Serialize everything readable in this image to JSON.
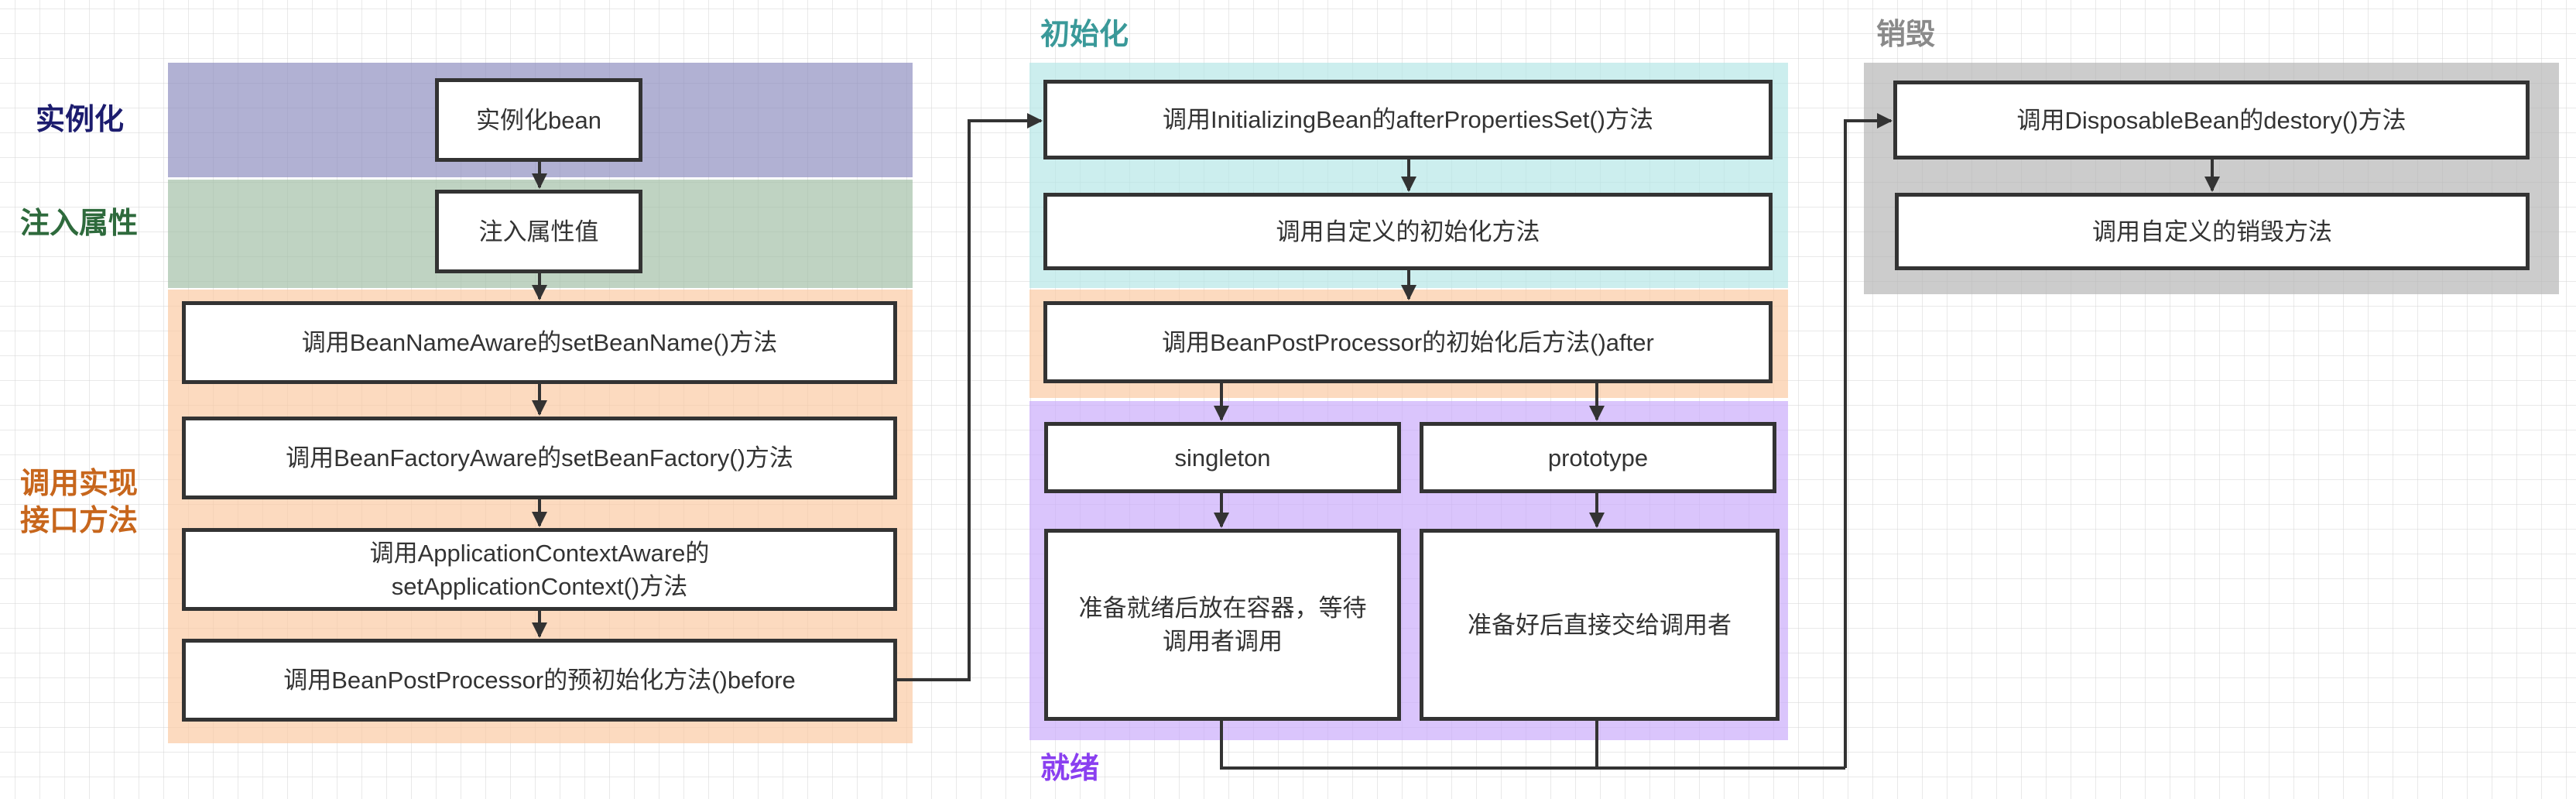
{
  "colors": {
    "label_instantiate": "#1c1c6e",
    "label_inject": "#2e6a3c",
    "label_aware": "#c7661c",
    "label_init": "#3a9999",
    "label_ready": "#8a3ff0",
    "label_destroy": "#8a8a8a",
    "stroke": "#333333"
  },
  "phases": {
    "instantiate": {
      "label": "实例化"
    },
    "inject": {
      "label": "注入属性"
    },
    "aware": {
      "label_line1": "调用实现",
      "label_line2": "接口方法"
    },
    "init": {
      "label": "初始化"
    },
    "ready": {
      "label": "就绪"
    },
    "destroy": {
      "label": "销毁"
    }
  },
  "nodes": {
    "instantiate_bean": "实例化bean",
    "inject_properties": "注入属性值",
    "bean_name_aware": "调用BeanNameAware的setBeanName()方法",
    "bean_factory_aware": "调用BeanFactoryAware的setBeanFactory()方法",
    "app_context_aware_line1": "调用ApplicationContextAware的",
    "app_context_aware_line2": "setApplicationContext()方法",
    "post_processor_before": "调用BeanPostProcessor的预初始化方法()before",
    "initializing_bean": "调用InitializingBean的afterPropertiesSet()方法",
    "custom_init": "调用自定义的初始化方法",
    "post_processor_after": "调用BeanPostProcessor的初始化后方法()after",
    "singleton": "singleton",
    "prototype": "prototype",
    "singleton_ready": "准备就绪后放在容器，等待调用者调用",
    "prototype_ready": "准备好后直接交给调用者",
    "disposable_bean": "调用DisposableBean的destory()方法",
    "custom_destroy": "调用自定义的销毁方法"
  }
}
